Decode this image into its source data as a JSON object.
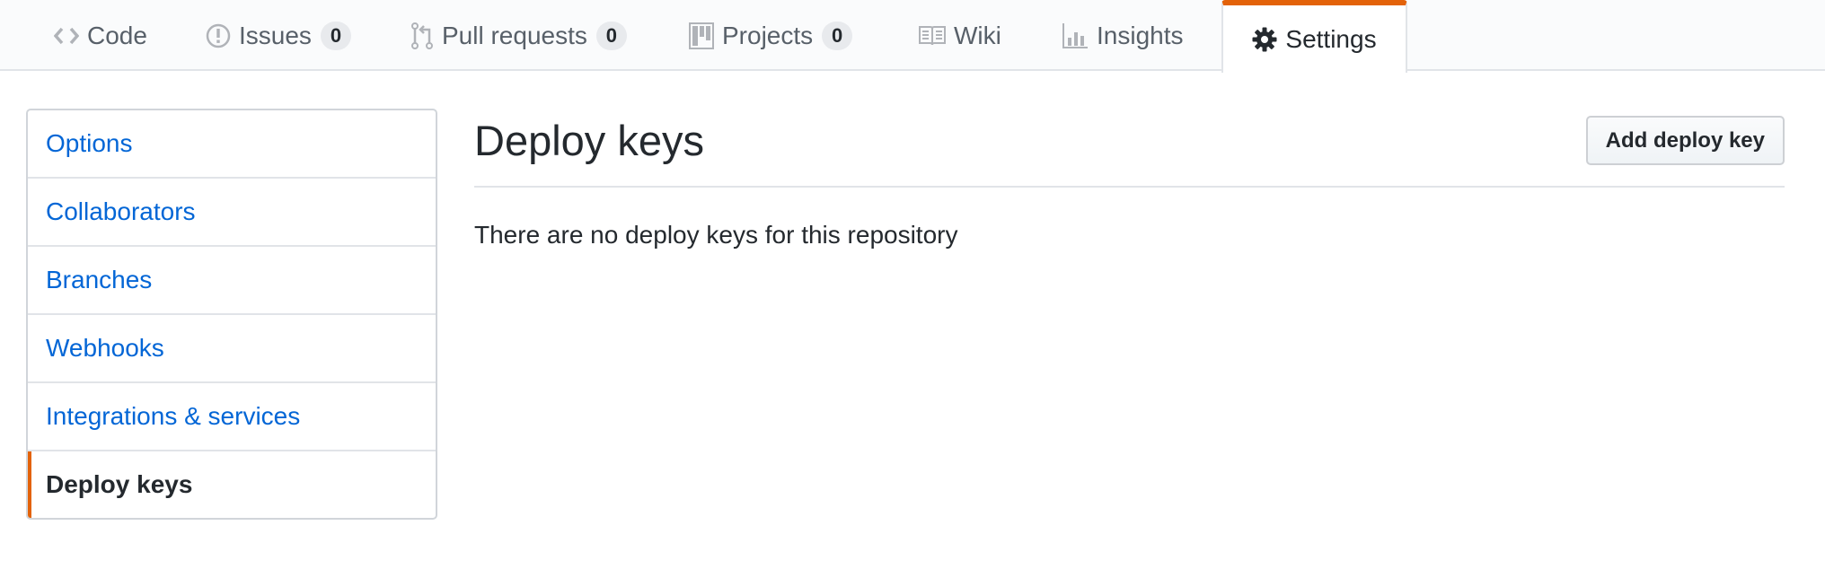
{
  "repo_nav": {
    "tabs": [
      {
        "label": "Code",
        "icon": "code-icon",
        "count": null,
        "selected": false
      },
      {
        "label": "Issues",
        "icon": "issue-opened-icon",
        "count": "0",
        "selected": false
      },
      {
        "label": "Pull requests",
        "icon": "git-pull-request-icon",
        "count": "0",
        "selected": false
      },
      {
        "label": "Projects",
        "icon": "project-icon",
        "count": "0",
        "selected": false
      },
      {
        "label": "Wiki",
        "icon": "book-icon",
        "count": null,
        "selected": false
      },
      {
        "label": "Insights",
        "icon": "graph-icon",
        "count": null,
        "selected": false
      },
      {
        "label": "Settings",
        "icon": "gear-icon",
        "count": null,
        "selected": true
      }
    ]
  },
  "sidebar": {
    "items": [
      {
        "label": "Options",
        "selected": false
      },
      {
        "label": "Collaborators",
        "selected": false
      },
      {
        "label": "Branches",
        "selected": false
      },
      {
        "label": "Webhooks",
        "selected": false
      },
      {
        "label": "Integrations & services",
        "selected": false
      },
      {
        "label": "Deploy keys",
        "selected": true
      }
    ]
  },
  "main": {
    "title": "Deploy keys",
    "add_button_label": "Add deploy key",
    "empty_message": "There are no deploy keys for this repository"
  },
  "colors": {
    "accent": "#e36209",
    "link": "#0366d6",
    "text": "#24292e",
    "muted": "#586069"
  }
}
